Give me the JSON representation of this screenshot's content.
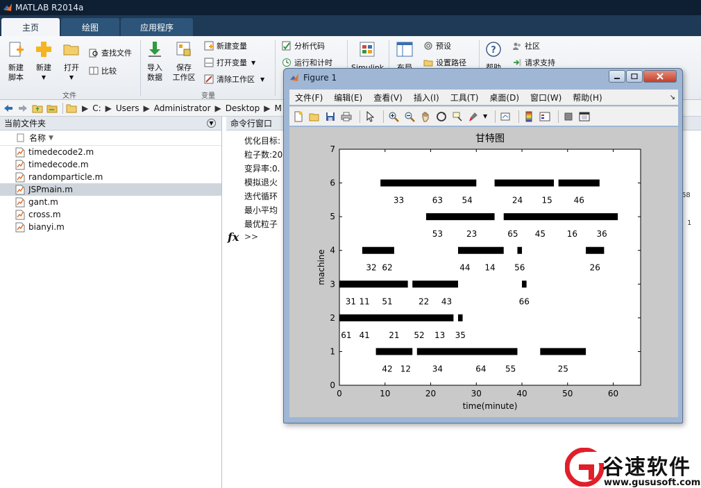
{
  "app": {
    "title": "MATLAB R2014a"
  },
  "ribbon": {
    "tabs": [
      {
        "label": "主页"
      },
      {
        "label": "绘图"
      },
      {
        "label": "应用程序"
      }
    ],
    "new_script_line1": "新建",
    "new_script_line2": "脚本",
    "new_label": "新建",
    "open_label": "打开",
    "find_files": "查找文件",
    "compare": "比较",
    "group_file": "文件",
    "import_line1": "导入",
    "import_line2": "数据",
    "save_ws_line1": "保存",
    "save_ws_line2": "工作区",
    "new_variable": "新建变量",
    "open_variable": "打开变量",
    "clear_workspace": "清除工作区",
    "group_variable": "变量",
    "analyze_code": "分析代码",
    "run_and_time": "运行和计时",
    "simulink": "Simulink",
    "layout": "布局",
    "preferences": "预设",
    "set_path": "设置路径",
    "help": "帮助",
    "community": "社区",
    "request_support": "请求支持"
  },
  "address": {
    "crumbs": [
      "C:",
      "Users",
      "Administrator",
      "Desktop",
      "M"
    ]
  },
  "folder_panel": {
    "title": "当前文件夹",
    "column_name": "名称",
    "files": [
      {
        "name": "timedecode2.m"
      },
      {
        "name": "timedecode.m"
      },
      {
        "name": "randomparticle.m"
      },
      {
        "name": "JSPmain.m"
      },
      {
        "name": "gant.m"
      },
      {
        "name": "cross.m"
      },
      {
        "name": "bianyi.m"
      }
    ]
  },
  "command_window": {
    "title": "命令行窗口",
    "lines": [
      "优化目标:",
      "粒子数:20",
      "变异率:0.",
      "模拟退火",
      "迭代循环",
      "最小平均",
      "最优粒子"
    ],
    "fx": "fx",
    "prompt": ">>",
    "right_text_1": "68",
    "right_text_2": "1"
  },
  "figure": {
    "title": "Figure 1",
    "menus": [
      "文件(F)",
      "编辑(E)",
      "查看(V)",
      "插入(I)",
      "工具(T)",
      "桌面(D)",
      "窗口(W)",
      "帮助(H)"
    ],
    "dock_arrow": "↘"
  },
  "chart_data": {
    "type": "gantt",
    "title": "甘特图",
    "xlabel": "time(minute)",
    "ylabel": "machine",
    "xlim": [
      0,
      66
    ],
    "ylim": [
      0,
      7
    ],
    "xticks": [
      0,
      10,
      20,
      30,
      40,
      50,
      60
    ],
    "yticks": [
      0,
      1,
      2,
      3,
      4,
      5,
      6,
      7
    ],
    "bars": [
      {
        "machine": 6,
        "start": 9,
        "end": 30
      },
      {
        "machine": 6,
        "start": 34,
        "end": 47
      },
      {
        "machine": 6,
        "start": 48,
        "end": 57
      },
      {
        "machine": 5,
        "start": 19,
        "end": 34
      },
      {
        "machine": 5,
        "start": 36,
        "end": 61
      },
      {
        "machine": 4,
        "start": 5,
        "end": 12
      },
      {
        "machine": 4,
        "start": 26,
        "end": 36
      },
      {
        "machine": 4,
        "start": 39,
        "end": 40
      },
      {
        "machine": 4,
        "start": 54,
        "end": 58
      },
      {
        "machine": 3,
        "start": 0,
        "end": 15
      },
      {
        "machine": 3,
        "start": 16,
        "end": 26
      },
      {
        "machine": 3,
        "start": 40,
        "end": 41
      },
      {
        "machine": 2,
        "start": 0,
        "end": 25
      },
      {
        "machine": 2,
        "start": 26,
        "end": 27
      },
      {
        "machine": 1,
        "start": 8,
        "end": 16
      },
      {
        "machine": 1,
        "start": 17,
        "end": 39
      },
      {
        "machine": 1,
        "start": 44,
        "end": 54
      }
    ],
    "labels": [
      {
        "machine": 6,
        "x": 13,
        "text": "33"
      },
      {
        "machine": 6,
        "x": 21.5,
        "text": "63"
      },
      {
        "machine": 6,
        "x": 28,
        "text": "54"
      },
      {
        "machine": 6,
        "x": 39,
        "text": "24"
      },
      {
        "machine": 6,
        "x": 45.5,
        "text": "15"
      },
      {
        "machine": 6,
        "x": 52.5,
        "text": "46"
      },
      {
        "machine": 5,
        "x": 21.5,
        "text": "53"
      },
      {
        "machine": 5,
        "x": 29,
        "text": "23"
      },
      {
        "machine": 5,
        "x": 38,
        "text": "65"
      },
      {
        "machine": 5,
        "x": 44,
        "text": "45"
      },
      {
        "machine": 5,
        "x": 51,
        "text": "16"
      },
      {
        "machine": 5,
        "x": 57.5,
        "text": "36"
      },
      {
        "machine": 4,
        "x": 7,
        "text": "32"
      },
      {
        "machine": 4,
        "x": 10.5,
        "text": "62"
      },
      {
        "machine": 4,
        "x": 27.5,
        "text": "44"
      },
      {
        "machine": 4,
        "x": 33,
        "text": "14"
      },
      {
        "machine": 4,
        "x": 39.5,
        "text": "56"
      },
      {
        "machine": 4,
        "x": 56,
        "text": "26"
      },
      {
        "machine": 3,
        "x": 2.5,
        "text": "31"
      },
      {
        "machine": 3,
        "x": 5.5,
        "text": "11"
      },
      {
        "machine": 3,
        "x": 10.5,
        "text": "51"
      },
      {
        "machine": 3,
        "x": 18.5,
        "text": "22"
      },
      {
        "machine": 3,
        "x": 23.5,
        "text": "43"
      },
      {
        "machine": 3,
        "x": 40.5,
        "text": "66"
      },
      {
        "machine": 2,
        "x": 1.5,
        "text": "61"
      },
      {
        "machine": 2,
        "x": 5.5,
        "text": "41"
      },
      {
        "machine": 2,
        "x": 12,
        "text": "21"
      },
      {
        "machine": 2,
        "x": 17.5,
        "text": "52"
      },
      {
        "machine": 2,
        "x": 22,
        "text": "13"
      },
      {
        "machine": 2,
        "x": 26.5,
        "text": "35"
      },
      {
        "machine": 1,
        "x": 10.5,
        "text": "42"
      },
      {
        "machine": 1,
        "x": 14.5,
        "text": "12"
      },
      {
        "machine": 1,
        "x": 21.5,
        "text": "34"
      },
      {
        "machine": 1,
        "x": 31,
        "text": "64"
      },
      {
        "machine": 1,
        "x": 37.5,
        "text": "55"
      },
      {
        "machine": 1,
        "x": 49,
        "text": "25"
      }
    ]
  },
  "watermark": {
    "text": "谷速软件",
    "url": "www.gususoft.com"
  },
  "colors": {
    "title_bar": "#0f1f33",
    "tab_strip": "#1f3a57",
    "bar": "#000000",
    "figure_frame": "#9fb7d4"
  }
}
